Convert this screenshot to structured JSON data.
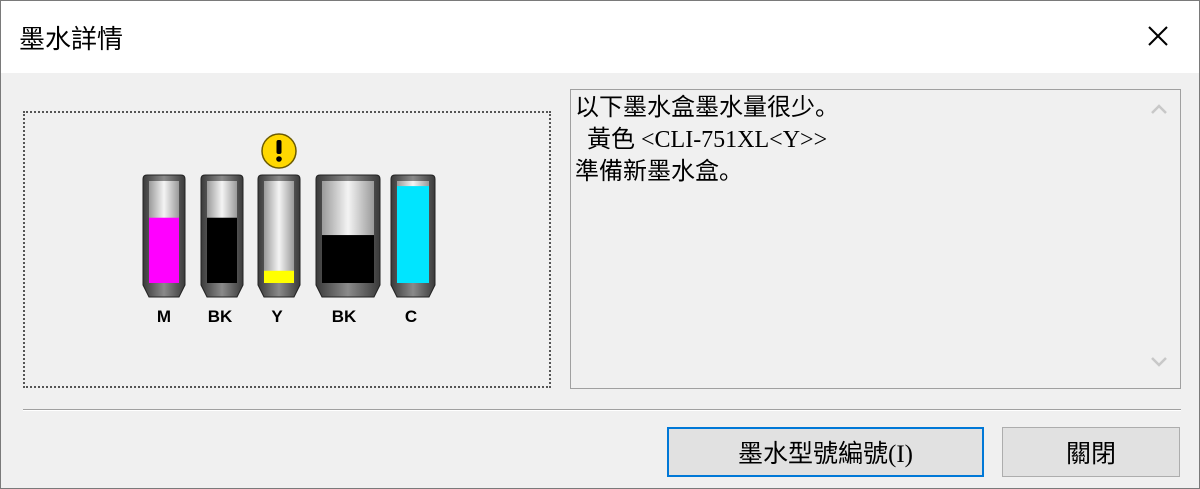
{
  "window": {
    "title": "墨水詳情",
    "close_icon": "close-x-icon"
  },
  "ink_panel": {
    "warning_icon": "exclamation-warning-icon",
    "warning_color": "#ffd800",
    "cartridges": [
      {
        "label": "M",
        "color": "#ff00ff",
        "level": 0.64,
        "warning": false
      },
      {
        "label": "BK",
        "color": "#000000",
        "level": 0.64,
        "warning": false
      },
      {
        "label": "Y",
        "color": "#ffff00",
        "level": 0.12,
        "warning": true
      },
      {
        "label": "BK",
        "color": "#000000",
        "level": 0.47,
        "warning": false
      },
      {
        "label": "C",
        "color": "#00e5ff",
        "level": 0.95,
        "warning": false
      }
    ]
  },
  "message": {
    "lines": [
      "以下墨水盒墨水量很少。",
      "  黃色 <CLI-751XL<Y>>",
      "準備新墨水盒。"
    ],
    "scroll_up_icon": "chevron-up-icon",
    "scroll_down_icon": "chevron-down-icon"
  },
  "buttons": {
    "ink_model": "墨水型號編號(I)",
    "close": "關閉"
  }
}
